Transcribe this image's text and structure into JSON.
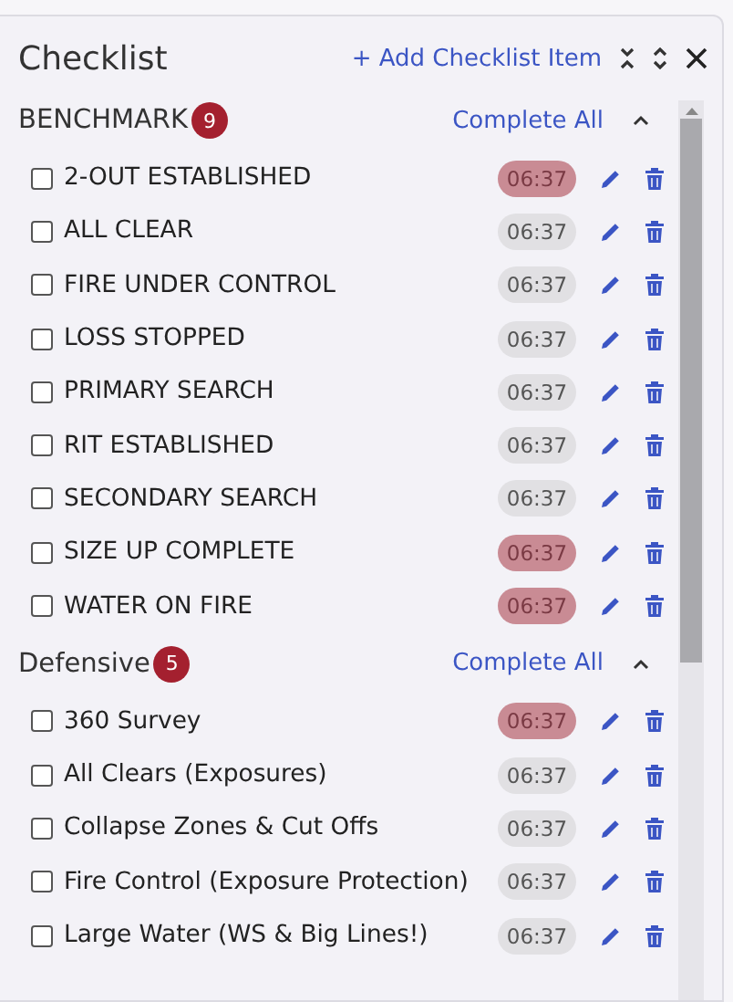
{
  "panel": {
    "title": "Checklist",
    "add_button": "+ Add Checklist Item"
  },
  "sections": [
    {
      "name": "BENCHMARK",
      "count": "9",
      "action": "Complete All",
      "expanded": true,
      "items": [
        {
          "label": "2-OUT ESTABLISHED",
          "checked": false,
          "time": "06:37",
          "overdue": true
        },
        {
          "label": "ALL CLEAR",
          "checked": false,
          "time": "06:37",
          "overdue": false
        },
        {
          "label": "FIRE UNDER CONTROL",
          "checked": false,
          "time": "06:37",
          "overdue": false
        },
        {
          "label": "LOSS STOPPED",
          "checked": false,
          "time": "06:37",
          "overdue": false
        },
        {
          "label": "PRIMARY SEARCH",
          "checked": false,
          "time": "06:37",
          "overdue": false
        },
        {
          "label": "RIT ESTABLISHED",
          "checked": false,
          "time": "06:37",
          "overdue": false
        },
        {
          "label": "SECONDARY SEARCH",
          "checked": false,
          "time": "06:37",
          "overdue": false
        },
        {
          "label": "SIZE UP COMPLETE",
          "checked": false,
          "time": "06:37",
          "overdue": true
        },
        {
          "label": "WATER ON FIRE",
          "checked": false,
          "time": "06:37",
          "overdue": true
        }
      ]
    },
    {
      "name": "Defensive",
      "count": "5",
      "action": "Complete All",
      "expanded": true,
      "items": [
        {
          "label": "360 Survey",
          "checked": false,
          "time": "06:37",
          "overdue": true
        },
        {
          "label": "All Clears (Exposures)",
          "checked": false,
          "time": "06:37",
          "overdue": false
        },
        {
          "label": "Collapse Zones & Cut Offs",
          "checked": false,
          "time": "06:37",
          "overdue": false
        },
        {
          "label": "Fire Control (Exposure Protection)",
          "checked": false,
          "time": "06:37",
          "overdue": false
        },
        {
          "label": "Large Water (WS & Big Lines!)",
          "checked": false,
          "time": "06:37",
          "overdue": false
        }
      ]
    }
  ]
}
